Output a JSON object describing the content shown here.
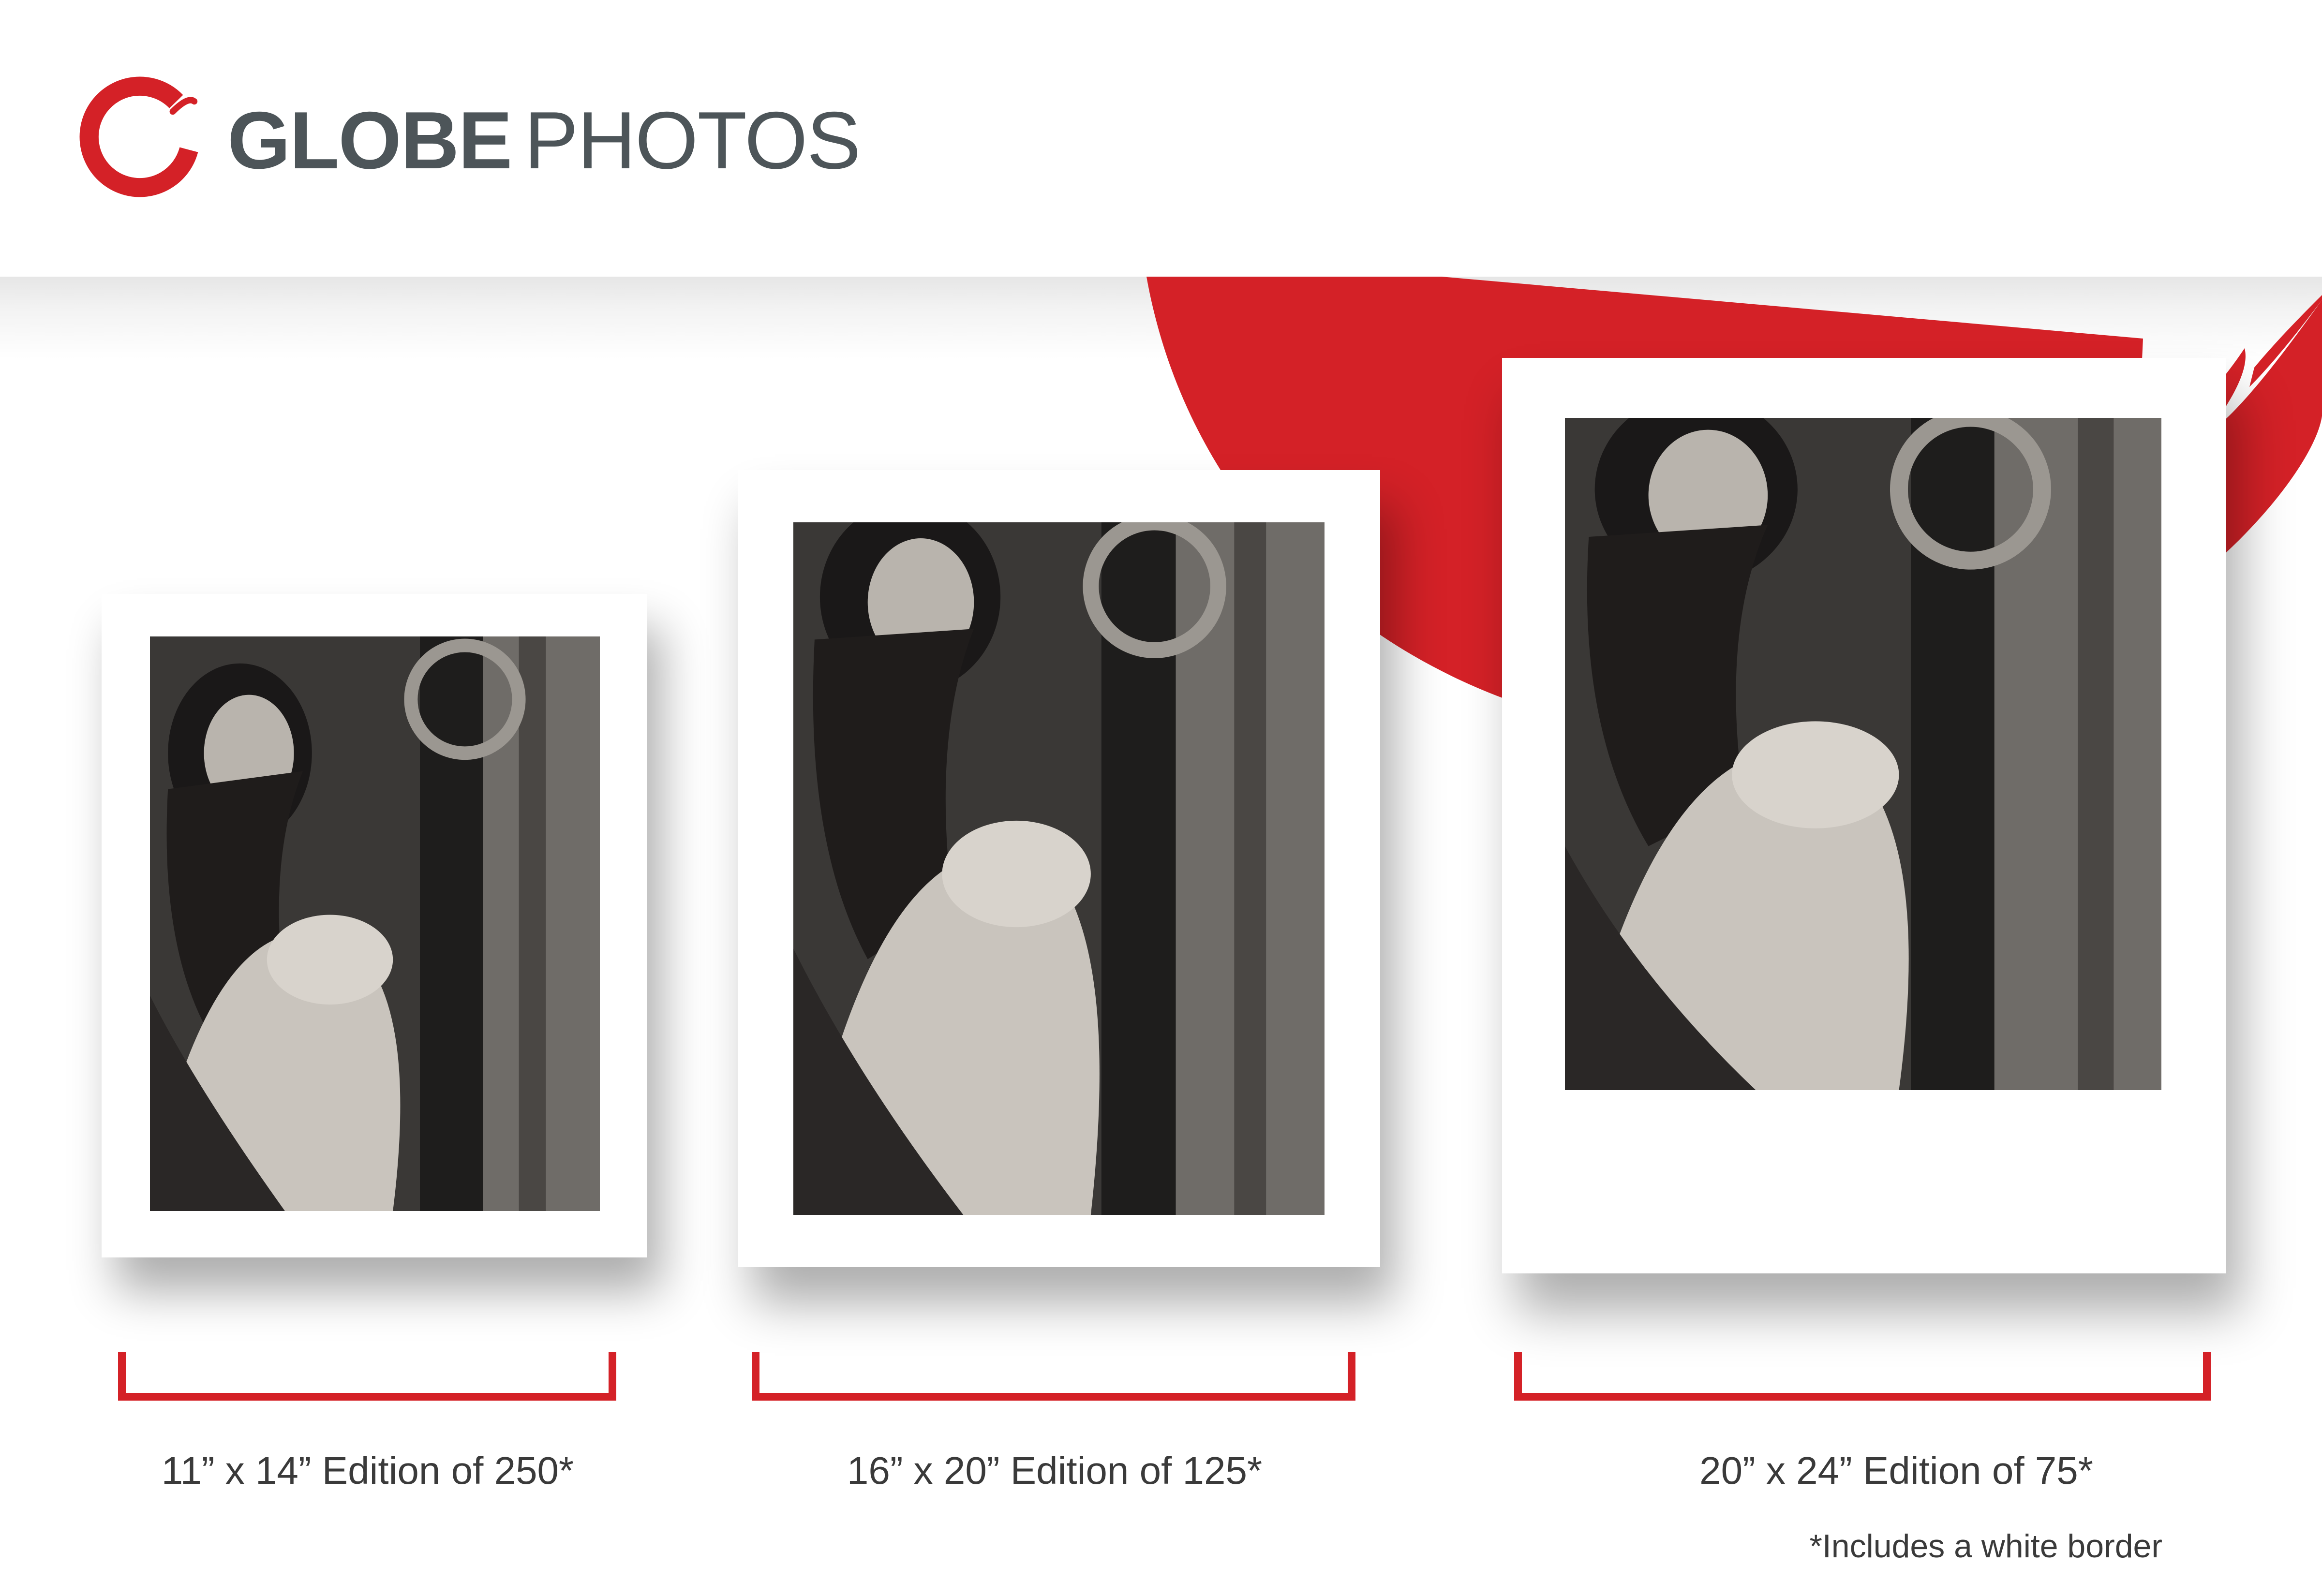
{
  "brand": {
    "name_bold": "GLOBE",
    "name_light": "PHOTOS",
    "logo_icon": "red-brush-circle-icon",
    "accent_color": "#d42127",
    "text_color": "#4d5559"
  },
  "prints": [
    {
      "label": "11” x 14” Edition of 250*"
    },
    {
      "label": "16” x 20” Edition of 125*"
    },
    {
      "label": "20” x 24” Edition of 75*"
    }
  ],
  "footnote": "*Includes a white border"
}
